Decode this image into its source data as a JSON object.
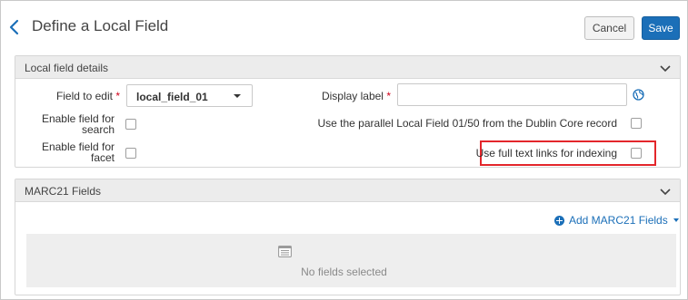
{
  "header": {
    "title": "Define a Local Field",
    "cancel_label": "Cancel",
    "save_label": "Save"
  },
  "local_panel": {
    "title": "Local field details",
    "field_to_edit_label": "Field to edit",
    "field_to_edit_value": "local_field_01",
    "display_label_label": "Display label",
    "display_label_value": "",
    "enable_search_label_line1": "Enable field for",
    "enable_search_label_line2": "search",
    "enable_search_checked": false,
    "enable_facet_label_line1": "Enable field for",
    "enable_facet_label_line2": "facet",
    "enable_facet_checked": false,
    "parallel_label": "Use the parallel Local Field 01/50 from the Dublin Core record",
    "parallel_checked": false,
    "fulltext_label": "Use full text links for indexing",
    "fulltext_checked": false,
    "required_marker": "*"
  },
  "marc_panel": {
    "title": "MARC21 Fields",
    "add_label": "Add MARC21 Fields",
    "empty_text": "No fields selected"
  },
  "icons": {
    "back": "chevron-left-icon",
    "collapse": "chevron-down-icon",
    "globe": "globe-icon",
    "add": "plus-circle-icon",
    "empty": "list-icon"
  },
  "colors": {
    "accent": "#1b6fb8",
    "highlight": "#e3262b",
    "required": "#d0021b"
  }
}
